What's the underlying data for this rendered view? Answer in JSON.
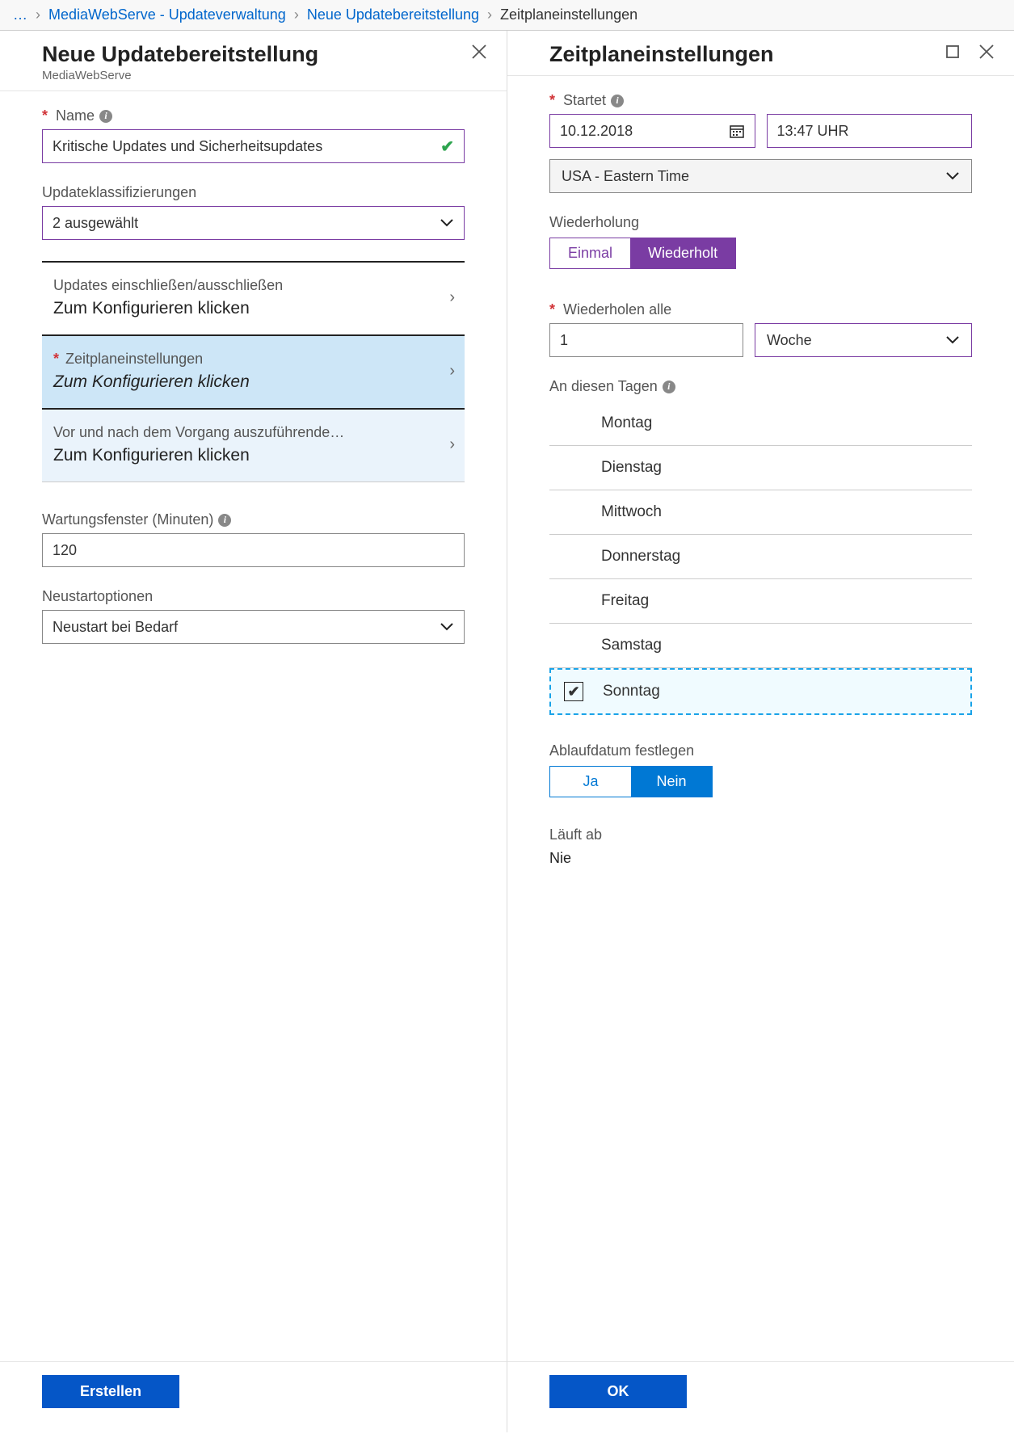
{
  "breadcrumb": {
    "ellipsis": "…",
    "items": [
      "MediaWebServe - Updateverwaltung",
      "Neue Updatebereitstellung",
      "Zeitplaneinstellungen"
    ]
  },
  "left": {
    "title": "Neue Updatebereitstellung",
    "subtitle": "MediaWebServe",
    "name_label": "Name",
    "name_value": "Kritische Updates und Sicherheitsupdates",
    "class_label": "Updateklassifizierungen",
    "class_value": "2 ausgewählt",
    "nav": [
      {
        "top": "Updates einschließen/ausschließen",
        "bottom": "Zum Konfigurieren klicken",
        "req": false
      },
      {
        "top": "Zeitplaneinstellungen",
        "bottom": "Zum Konfigurieren klicken",
        "req": true
      },
      {
        "top": "Vor und nach dem Vorgang auszuführende…",
        "bottom": "Zum Konfigurieren klicken",
        "req": false
      }
    ],
    "maint_label": "Wartungsfenster (Minuten)",
    "maint_value": "120",
    "restart_label": "Neustartoptionen",
    "restart_value": "Neustart bei Bedarf",
    "create_btn": "Erstellen"
  },
  "right": {
    "title": "Zeitplaneinstellungen",
    "start_label": "Startet",
    "start_date": "10.12.2018",
    "start_time": "13:47 UHR",
    "timezone": "USA - Eastern Time",
    "recur_label": "Wiederholung",
    "recur_once": "Einmal",
    "recur_repeat": "Wiederholt",
    "repeat_every_label": "Wiederholen alle",
    "repeat_every_value": "1",
    "repeat_unit": "Woche",
    "days_label": "An diesen Tagen",
    "days": [
      "Montag",
      "Dienstag",
      "Mittwoch",
      "Donnerstag",
      "Freitag",
      "Samstag",
      "Sonntag"
    ],
    "selected_day_index": 6,
    "expiry_set_label": "Ablaufdatum festlegen",
    "yes": "Ja",
    "no": "Nein",
    "expires_label": "Läuft ab",
    "expires_value": "Nie",
    "ok_btn": "OK"
  }
}
